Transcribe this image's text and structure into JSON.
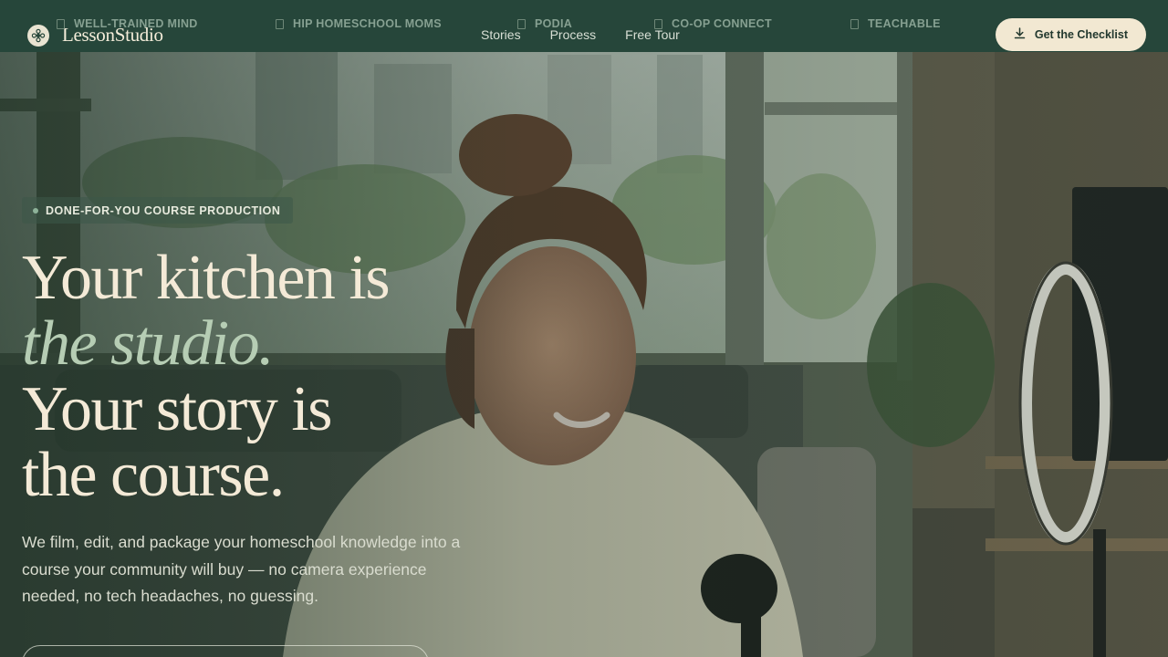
{
  "brand": {
    "name": "LessonStudio"
  },
  "partners": [
    {
      "label": "WELL-TRAINED MIND"
    },
    {
      "label": "HIP HOMESCHOOL MOMS"
    },
    {
      "label": "PODIA"
    },
    {
      "label": "CO-OP CONNECT"
    },
    {
      "label": "TEACHABLE"
    }
  ],
  "nav": {
    "items": [
      {
        "label": "Stories"
      },
      {
        "label": "Process"
      },
      {
        "label": "Free Tour"
      }
    ]
  },
  "header_cta": {
    "label": "Get the Checklist",
    "icon": "download-icon"
  },
  "hero": {
    "eyebrow": "DONE-FOR-YOU COURSE PRODUCTION",
    "headline_line1": "Your kitchen is",
    "headline_accent": "the studio.",
    "headline_line3": "Your story is",
    "headline_line4": "the course.",
    "lede": "We film, edit, and package your homeschool knowledge into a course your community will buy — no camera experience needed, no tech headaches, no guessing."
  },
  "colors": {
    "header_bg": "#26463a",
    "cta_bg": "#f2e8d2",
    "headline": "#f4ead7",
    "accent": "#b6cdb4"
  }
}
